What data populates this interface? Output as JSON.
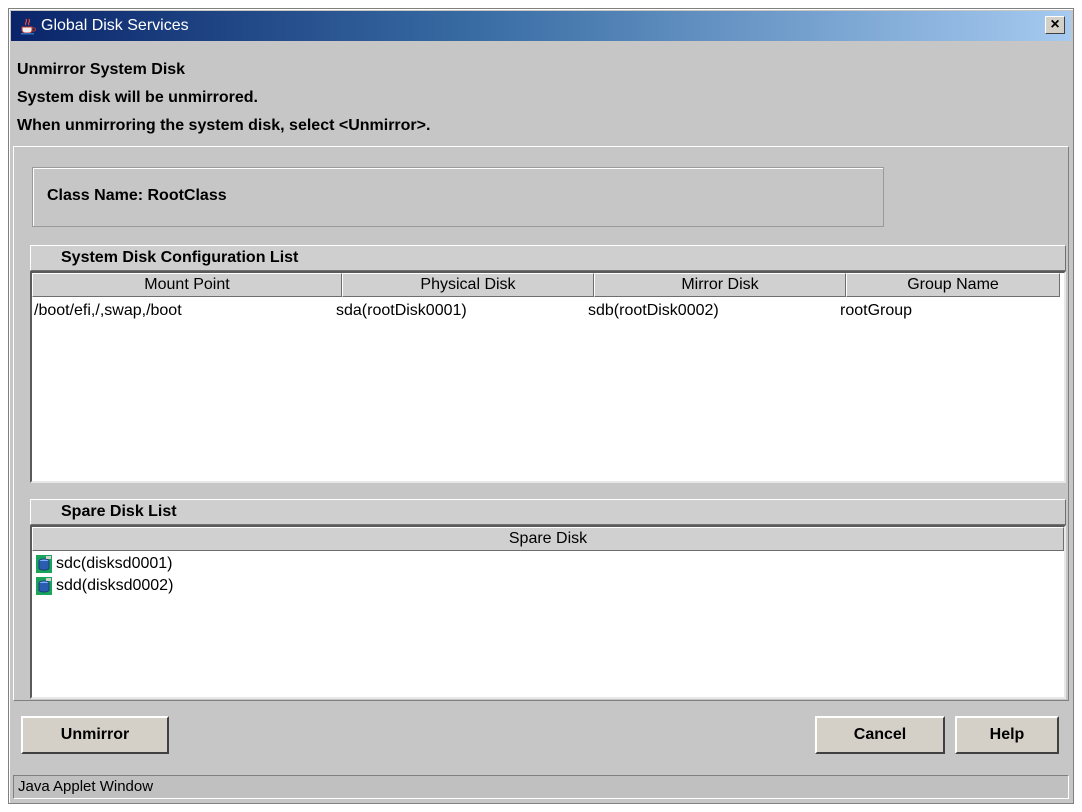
{
  "window": {
    "title": "Global Disk Services",
    "close_label": "×",
    "icon": "java-coffee-cup-icon"
  },
  "header": {
    "line1": "Unmirror System Disk",
    "line2": "System disk will be unmirrored.",
    "line3": "When unmirroring the system disk, select <Unmirror>."
  },
  "class_info": {
    "text": "Class Name: RootClass"
  },
  "system_disk_list": {
    "title": "System Disk Configuration List",
    "columns": [
      "Mount Point",
      "Physical Disk",
      "Mirror Disk",
      "Group Name"
    ],
    "rows": [
      [
        "/boot/efi,/,swap,/boot",
        "sda(rootDisk0001)",
        "sdb(rootDisk0002)",
        "rootGroup"
      ]
    ]
  },
  "spare_disk_list": {
    "title": "Spare Disk List",
    "column": "Spare Disk",
    "items": [
      {
        "label": "sdc(disksd0001)",
        "icon": "disk-icon"
      },
      {
        "label": "sdd(disksd0002)",
        "icon": "disk-icon"
      }
    ]
  },
  "buttons": {
    "unmirror": "Unmirror",
    "cancel": "Cancel",
    "help": "Help"
  },
  "status": {
    "text": "Java Applet Window"
  },
  "colors": {
    "title_start": "#0a246a",
    "title_end": "#a6caf0",
    "window_bg": "#c6c6c6",
    "disk_icon_green": "#1aa35a",
    "disk_icon_blue": "#2a5db0"
  }
}
